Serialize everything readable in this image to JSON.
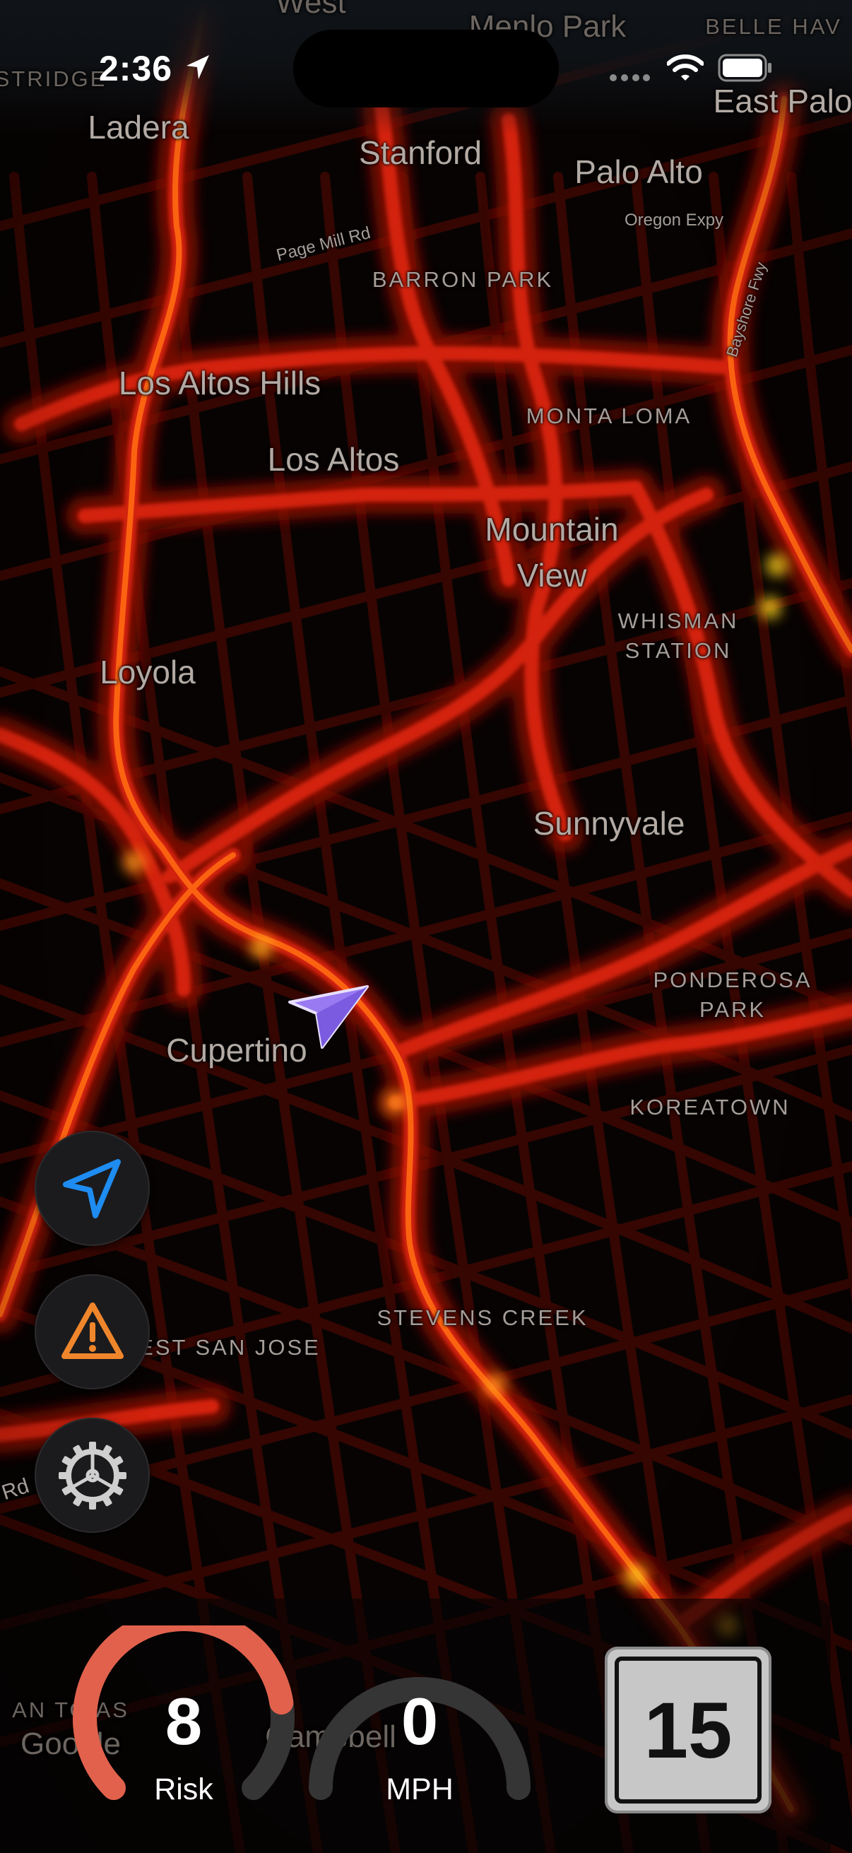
{
  "status_bar": {
    "time": "2:36"
  },
  "map": {
    "cities": [
      {
        "id": "east-palo-alto",
        "text": "East Palo"
      },
      {
        "id": "ladera",
        "text": "Ladera"
      },
      {
        "id": "stanford",
        "text": "Stanford"
      },
      {
        "id": "palo-alto",
        "text": "Palo Alto"
      },
      {
        "id": "los-altos-hills",
        "text": "Los Altos Hills"
      },
      {
        "id": "los-altos",
        "text": "Los Altos"
      },
      {
        "id": "mountain-view",
        "text": "Mountain View"
      },
      {
        "id": "loyola",
        "text": "Loyola"
      },
      {
        "id": "sunnyvale",
        "text": "Sunnyvale"
      },
      {
        "id": "cupertino",
        "text": "Cupertino"
      }
    ],
    "neighborhoods": [
      {
        "id": "barron-park",
        "text": "BARRON PARK"
      },
      {
        "id": "monta-loma",
        "text": "MONTA LOMA"
      },
      {
        "id": "whisman-station",
        "text": "WHISMAN STATION"
      },
      {
        "id": "ponderosa-park",
        "text": "PONDEROSA PARK"
      },
      {
        "id": "koreatown",
        "text": "KOREATOWN"
      },
      {
        "id": "stevens-creek",
        "text": "STEVENS CREEK"
      },
      {
        "id": "west-san-jose",
        "text": "EST SAN JOSE"
      },
      {
        "id": "belle-haven",
        "text": "BELLE HAV"
      },
      {
        "id": "stridge",
        "text": "STRIDGE"
      }
    ],
    "roads": [
      {
        "id": "page-mill-rd",
        "text": "Page Mill Rd"
      },
      {
        "id": "oregon-expy",
        "text": "Oregon Expy"
      },
      {
        "id": "bayshore-fwy",
        "text": "Bayshore Fwy"
      },
      {
        "id": "rd",
        "text": "Rd"
      }
    ],
    "faded": [
      {
        "id": "west-menlo",
        "text": "West"
      },
      {
        "id": "menlo-park",
        "text": "Menlo Park"
      },
      {
        "id": "campbell",
        "text": "Campbell"
      },
      {
        "id": "los-gatos",
        "text": "AN TO AS"
      }
    ],
    "attribution": "Google"
  },
  "controls": {
    "recenter_icon": "location-arrow-icon",
    "report_icon": "warning-icon",
    "settings_icon": "gear-icon"
  },
  "dashboard": {
    "risk": {
      "value": "8",
      "label": "Risk",
      "level": 0.8,
      "color": "#e2614c"
    },
    "speed": {
      "value": "0",
      "label": "MPH",
      "level": 0
    },
    "speed_limit": "15"
  },
  "colors": {
    "heat_outer": "#7a0a02",
    "heat_mid": "#e0260a",
    "heat_core": "#ff7a10",
    "heat_hot": "#ffd21a",
    "vehicle_arrow": "#9a7af2",
    "recenter_blue": "#1e8cf0",
    "warning_orange": "#f0862c",
    "gauge_bg": "#353535"
  }
}
